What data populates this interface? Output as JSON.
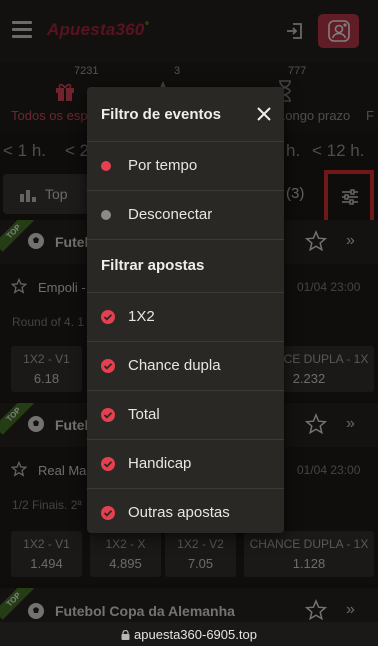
{
  "header": {
    "logo": "Apuesta360",
    "logo_mark": "°"
  },
  "categories": [
    {
      "count": "7231",
      "label": "Todos os esp",
      "icon": "gift-icon"
    },
    {
      "count": "3",
      "label": "",
      "icon": "star-icon"
    },
    {
      "count": "777",
      "label": "Longo prazo",
      "icon": "hourglass-icon"
    },
    {
      "count": "",
      "label": "F",
      "icon": ""
    }
  ],
  "time_filters": [
    "< 1 h.",
    "< 2",
    "h.",
    "< 12 h."
  ],
  "filter_bar": {
    "top_label": "Top",
    "count": "(3)"
  },
  "leagues": [
    {
      "name": "Futeb",
      "ribbon": "TOP",
      "match": {
        "team": "Empoli -",
        "date": "01/04 23:00",
        "round": "Round of 4. 1",
        "odds": [
          {
            "type": "1X2 - V1",
            "value": "6.18"
          },
          {
            "type": "CHANCE DUPLA - 1X",
            "value": "2.232"
          }
        ]
      }
    },
    {
      "name": "Futeb",
      "ribbon": "TOP",
      "match": {
        "team": "Real Mac",
        "date": "01/04 23:00",
        "round": "1/2 Finais. 2ª",
        "odds": [
          {
            "type": "1X2 - V1",
            "value": "1.494"
          },
          {
            "type": "1X2 - X",
            "value": "4.895"
          },
          {
            "type": "1X2 - V2",
            "value": "7.05"
          },
          {
            "type": "CHANCE DUPLA - 1X",
            "value": "1.128"
          }
        ]
      }
    },
    {
      "name": "Futebol Copa da Alemanha",
      "ribbon": "TOP"
    }
  ],
  "modal": {
    "title": "Filtro de eventos",
    "event_options": [
      {
        "label": "Por tempo",
        "color": "#e5404f"
      },
      {
        "label": "Desconectar",
        "color": "#8c8a86"
      }
    ],
    "bets_section": "Filtrar apostas",
    "bet_options": [
      "1X2",
      "Chance dupla",
      "Total",
      "Handicap",
      "Outras apostas"
    ],
    "accent": "#e5404f"
  },
  "browser": {
    "url": "apuesta360-6905.top"
  }
}
